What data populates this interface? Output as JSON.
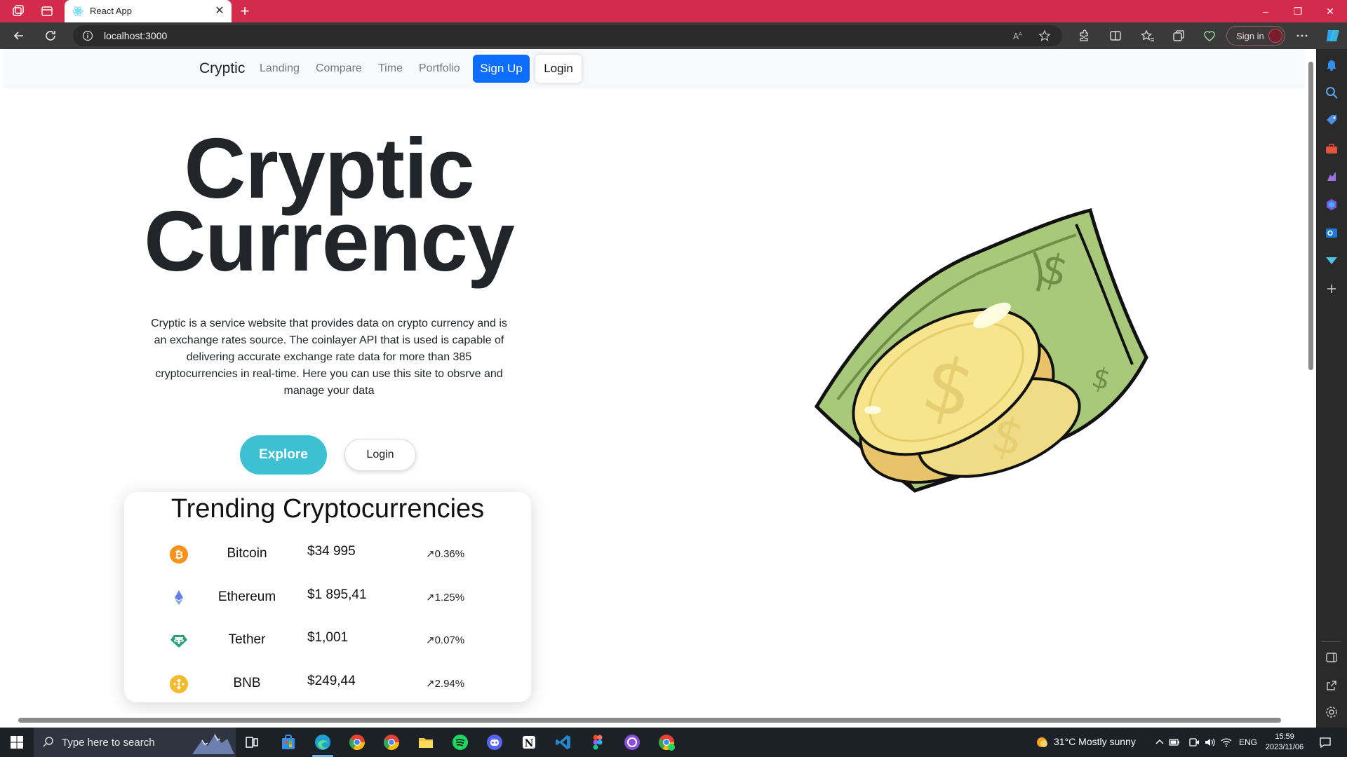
{
  "browser": {
    "tab_title": "React App",
    "url": "localhost:3000",
    "signin_label": "Sign in"
  },
  "navbar": {
    "brand": "Cryptic",
    "links": [
      "Landing",
      "Compare",
      "Time",
      "Portfolio"
    ],
    "signup_label": "Sign Up",
    "login_label": "Login"
  },
  "hero": {
    "title_line1": "Cryptic",
    "title_line2": "Currency",
    "description": "Cryptic is a service website that provides data on crypto currency and is an exchange rates source. The coinlayer API that is used is capable of delivering accurate exchange rate data for more than 385 cryptocurrencies in real-time. Here you can use this site to obsrve and manage your data",
    "explore_label": "Explore",
    "login_label": "Login"
  },
  "trending": {
    "title": "Trending Cryptocurrencies",
    "coins": [
      {
        "name": "Bitcoin",
        "price": "$34 995",
        "change": "↗0.36%",
        "icon": "bitcoin-icon",
        "color": "#f7931a"
      },
      {
        "name": "Ethereum",
        "price": "$1 895,41",
        "change": "↗1.25%",
        "icon": "ethereum-icon",
        "color": "#627eea"
      },
      {
        "name": "Tether",
        "price": "$1,001",
        "change": "↗0.07%",
        "icon": "tether-icon",
        "color": "#26a17b"
      },
      {
        "name": "BNB",
        "price": "$249,44",
        "change": "↗2.94%",
        "icon": "bnb-icon",
        "color": "#f3ba2f"
      }
    ]
  },
  "taskbar": {
    "search_placeholder": "Type here to search",
    "weather": "31°C  Mostly sunny",
    "language": "ENG",
    "time": "15:59",
    "date": "2023/11/06"
  },
  "colors": {
    "titlebar": "#d42a4b",
    "primary_button": "#0d6efd",
    "explore_button": "#3ec0d3"
  }
}
